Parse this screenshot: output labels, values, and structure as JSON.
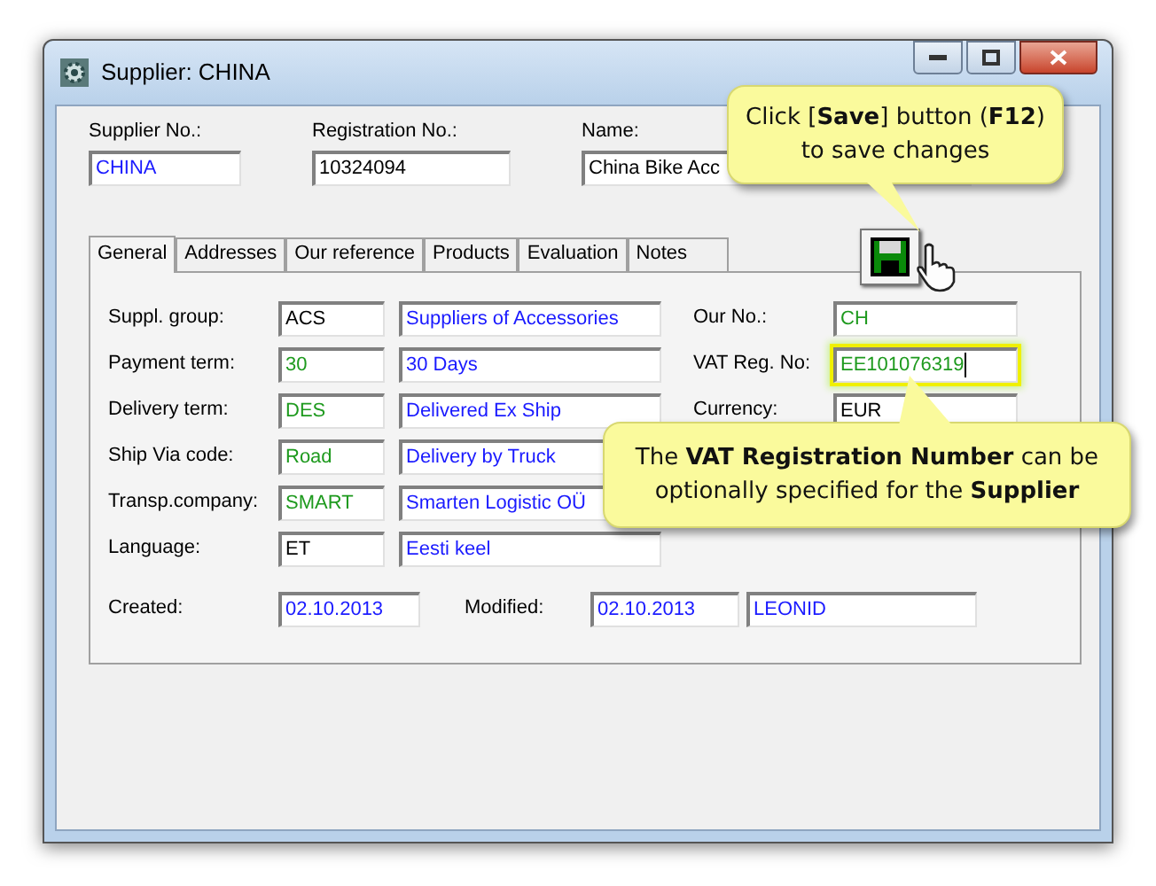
{
  "window": {
    "title": "Supplier: CHINA"
  },
  "header_fields": [
    {
      "label": "Supplier No.:",
      "value": "CHINA",
      "color": "#1a1aff"
    },
    {
      "label": "Registration No.:",
      "value": "10324094",
      "color": "#000000"
    },
    {
      "label": "Name:",
      "value": "China Bike Acc",
      "color": "#000000"
    }
  ],
  "tabs": [
    {
      "label": "General",
      "selected": true
    },
    {
      "label": "Addresses",
      "selected": false
    },
    {
      "label": "Our reference",
      "selected": false
    },
    {
      "label": "Products",
      "selected": false
    },
    {
      "label": "Evaluation",
      "selected": false
    },
    {
      "label": "Notes",
      "selected": false
    }
  ],
  "rows": [
    {
      "label": "Suppl. group:",
      "code": {
        "value": "ACS",
        "color": "#000000"
      },
      "description": {
        "value": "Suppliers of Accessories",
        "color": "#1a1aff"
      }
    },
    {
      "label": "Payment term:",
      "code": {
        "value": "30",
        "color": "#1e9a1e"
      },
      "description": {
        "value": "30 Days",
        "color": "#1a1aff"
      }
    },
    {
      "label": "Delivery term:",
      "code": {
        "value": "DES",
        "color": "#1e9a1e"
      },
      "description": {
        "value": "Delivered Ex Ship",
        "color": "#1a1aff"
      }
    },
    {
      "label": "Ship Via code:",
      "code": {
        "value": "Road",
        "color": "#1e9a1e"
      },
      "description": {
        "value": "Delivery by Truck",
        "color": "#1a1aff"
      }
    },
    {
      "label": "Transp.company:",
      "code": {
        "value": "SMART",
        "color": "#1e9a1e"
      },
      "description": {
        "value": "Smarten Logistic OÜ",
        "color": "#1a1aff"
      }
    },
    {
      "label": "Language:",
      "code": {
        "value": "ET",
        "color": "#000000"
      },
      "description": {
        "value": "Eesti keel",
        "color": "#1a1aff"
      }
    }
  ],
  "right_fields": [
    {
      "label": "Our No.:",
      "value": "CH",
      "color": "#1e9a1e",
      "focused": false
    },
    {
      "label": "VAT Reg. No:",
      "value": "EE101076319",
      "color": "#1e9a1e",
      "focused": true
    },
    {
      "label": "Currency:",
      "value": "EUR",
      "color": "#000000",
      "focused": false
    }
  ],
  "footer": {
    "created_label": "Created:",
    "created": "02.10.2013",
    "modified_label": "Modified:",
    "modified": "02.10.2013",
    "user": "LEONID"
  },
  "callouts": [
    {
      "text": "Click [**Save**] button (**F12**) to save changes"
    },
    {
      "text": "The **VAT Registration Number** can be optionally specified for the **Supplier**"
    }
  ]
}
